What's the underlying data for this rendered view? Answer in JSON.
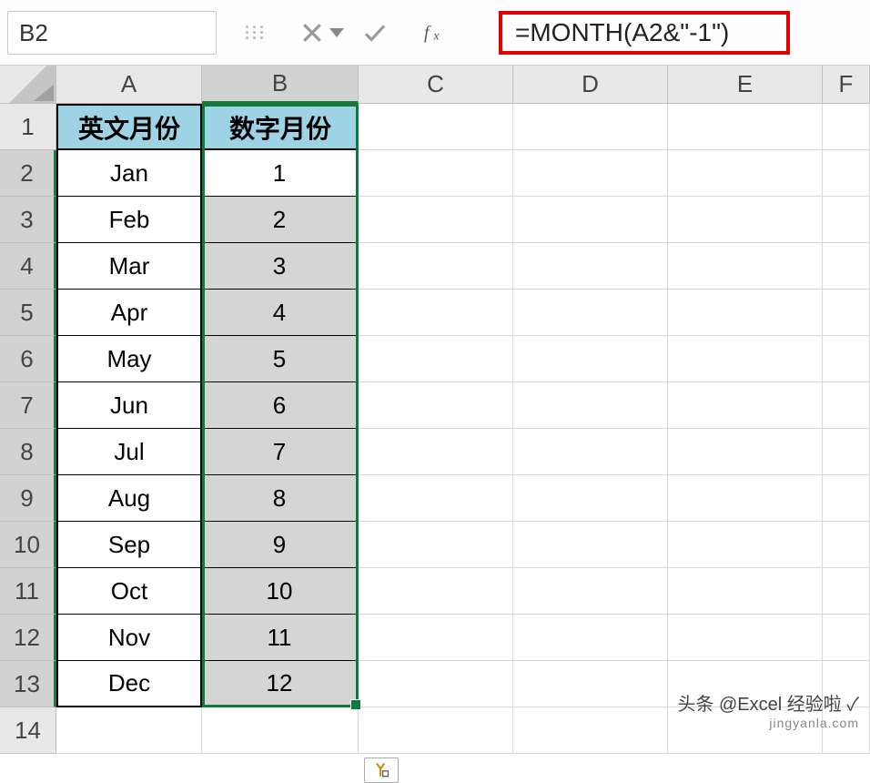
{
  "formula_bar": {
    "name_box_value": "B2",
    "formula": "=MONTH(A2&\"-1\")"
  },
  "columns": [
    "A",
    "B",
    "C",
    "D",
    "E",
    "F"
  ],
  "headers": {
    "col_a": "英文月份",
    "col_b": "数字月份"
  },
  "rows": [
    {
      "n": 1,
      "a": "英文月份",
      "b": "数字月份",
      "header": true
    },
    {
      "n": 2,
      "a": "Jan",
      "b": "1"
    },
    {
      "n": 3,
      "a": "Feb",
      "b": "2"
    },
    {
      "n": 4,
      "a": "Mar",
      "b": "3"
    },
    {
      "n": 5,
      "a": "Apr",
      "b": "4"
    },
    {
      "n": 6,
      "a": "May",
      "b": "5"
    },
    {
      "n": 7,
      "a": "Jun",
      "b": "6"
    },
    {
      "n": 8,
      "a": "Jul",
      "b": "7"
    },
    {
      "n": 9,
      "a": "Aug",
      "b": "8"
    },
    {
      "n": 10,
      "a": "Sep",
      "b": "9"
    },
    {
      "n": 11,
      "a": "Oct",
      "b": "10"
    },
    {
      "n": 12,
      "a": "Nov",
      "b": "11"
    },
    {
      "n": 13,
      "a": "Dec",
      "b": "12"
    },
    {
      "n": 14,
      "a": "",
      "b": ""
    }
  ],
  "colors": {
    "selection_border": "#0f7b3a",
    "header_fill": "#9ed3e6",
    "formula_highlight_border": "#e30000"
  },
  "watermark": {
    "line1": "头条 @Excel 经验啦 ✓",
    "line2": "jingyanla.com"
  }
}
